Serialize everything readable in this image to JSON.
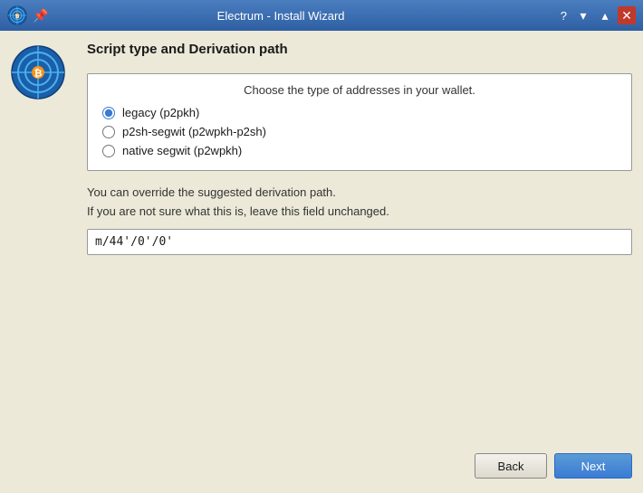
{
  "titleBar": {
    "title": "Electrum - Install Wizard",
    "helpLabel": "?",
    "minimizeLabel": "▾",
    "maximizeLabel": "▴",
    "closeLabel": "✕"
  },
  "section": {
    "title": "Script type and Derivation path"
  },
  "radioGroup": {
    "subtitle": "Choose the type of addresses in your wallet.",
    "options": [
      {
        "id": "legacy",
        "label": "legacy (p2pkh)",
        "checked": true
      },
      {
        "id": "p2sh-segwit",
        "label": "p2sh-segwit (p2wpkh-p2sh)",
        "checked": false
      },
      {
        "id": "native-segwit",
        "label": "native segwit (p2wpkh)",
        "checked": false
      }
    ]
  },
  "derivation": {
    "hint1": "You can override the suggested derivation path.",
    "hint2": "If you are not sure what this is, leave this field unchanged.",
    "value": "m/44'/0'/0'"
  },
  "buttons": {
    "back": "Back",
    "next": "Next"
  }
}
